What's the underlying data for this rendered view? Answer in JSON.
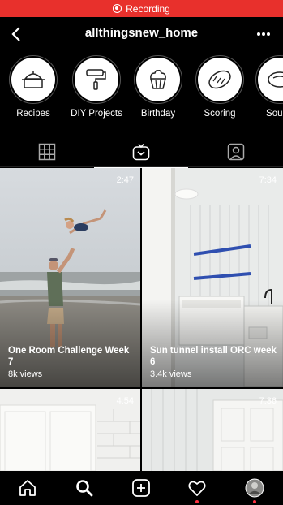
{
  "status_bar": {
    "label": "Recording",
    "color": "#e8302c"
  },
  "header": {
    "title": "allthingsnew_home"
  },
  "highlights": [
    {
      "label": "Recipes",
      "icon": "pot-icon"
    },
    {
      "label": "DIY Projects",
      "icon": "paint-roller-icon"
    },
    {
      "label": "Birthday",
      "icon": "cupcake-icon"
    },
    {
      "label": "Scoring",
      "icon": "bread-icon"
    },
    {
      "label": "Sour d",
      "icon": "bread-icon"
    }
  ],
  "tabs": [
    {
      "name": "grid",
      "icon": "grid-icon",
      "active": false
    },
    {
      "name": "igtv",
      "icon": "igtv-icon",
      "active": true
    },
    {
      "name": "tagged",
      "icon": "tagged-icon",
      "active": false
    }
  ],
  "videos": [
    {
      "duration": "2:47",
      "title": "One Room Challenge Week 7",
      "views": "8k views"
    },
    {
      "duration": "7:34",
      "title": "Sun tunnel install ORC week 6",
      "views": "3.4k views"
    },
    {
      "duration": "4:54",
      "title": "",
      "views": ""
    },
    {
      "duration": "7:36",
      "title": "",
      "views": ""
    }
  ],
  "nav": [
    {
      "name": "home",
      "icon": "home-icon"
    },
    {
      "name": "search",
      "icon": "search-icon"
    },
    {
      "name": "create",
      "icon": "plus-square-icon"
    },
    {
      "name": "activity",
      "icon": "heart-icon"
    },
    {
      "name": "profile",
      "icon": "avatar"
    }
  ]
}
